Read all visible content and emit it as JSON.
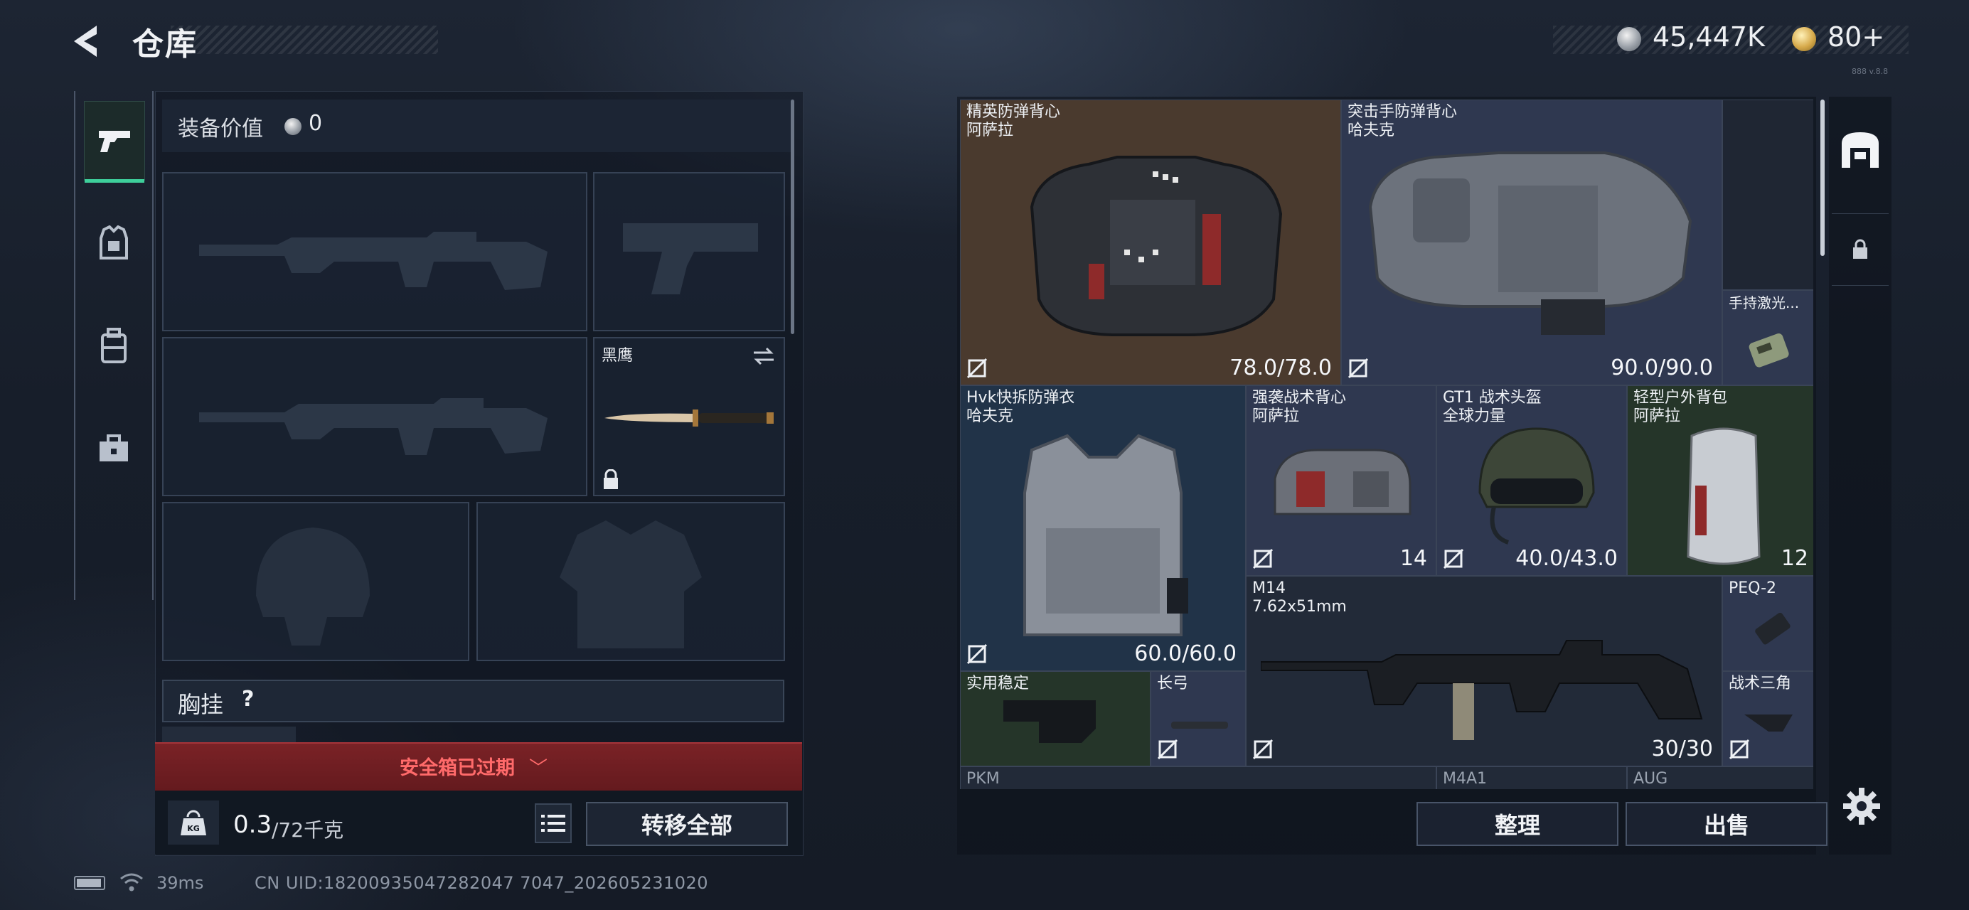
{
  "header": {
    "title": "仓库",
    "currency_amount": "45,447K",
    "token_amount": "80+",
    "version_tag": "888 v.8.8",
    "icons": {
      "back": "back-arrow-icon",
      "currency": "silver-coin-icon",
      "token": "gold-coin-icon"
    }
  },
  "left_rail": {
    "tabs": [
      {
        "name": "weapons",
        "icon": "pistol-icon",
        "active": true
      },
      {
        "name": "gear",
        "icon": "armor-icon",
        "active": false
      },
      {
        "name": "backpack",
        "icon": "backpack-icon",
        "active": false
      },
      {
        "name": "supplies",
        "icon": "toolbox-icon",
        "active": false
      }
    ]
  },
  "loadout": {
    "equip_value_label": "装备价值",
    "equip_value": "0",
    "melee_name": "黑鹰",
    "chest_rig_label": "胸挂",
    "chest_rig_help": "?",
    "safe_box_status": "安全箱已过期",
    "safe_box_chevron": "﹀",
    "weight_current": "0.3",
    "weight_limit": "/72千克",
    "transfer_all": "转移全部"
  },
  "status": {
    "ping": "39ms",
    "uid": "CN UID:18200935047282047 7047_202605231020"
  },
  "stash": {
    "items": [
      {
        "name": "精英防弹背心",
        "origin": "阿萨拉",
        "value": "78.0/78.0",
        "color": "tan"
      },
      {
        "name": "突击手防弹背心",
        "origin": "哈夫克",
        "value": "90.0/90.0",
        "color": "slate"
      },
      {
        "name": "手持激光...",
        "origin": "",
        "value": "",
        "color": "slate"
      },
      {
        "name": "Hvk快拆防弹衣",
        "origin": "哈夫克",
        "value": "60.0/60.0",
        "color": "blue"
      },
      {
        "name": "强袭战术背心",
        "origin": "阿萨拉",
        "value": "14",
        "color": "slate"
      },
      {
        "name": "GT1 战术头盔",
        "origin": "全球力量",
        "value": "40.0/43.0",
        "color": "slate"
      },
      {
        "name": "轻型户外背包",
        "origin": "阿萨拉",
        "value": "12",
        "color": "green"
      },
      {
        "name": "M14",
        "origin": "7.62x51mm",
        "value": "30/30",
        "color": "dark"
      },
      {
        "name": "PEQ-2",
        "origin": "",
        "value": "",
        "color": "slate"
      },
      {
        "name": "实用稳定",
        "origin": "",
        "value": "",
        "color": "green"
      },
      {
        "name": "长弓",
        "origin": "",
        "value": "",
        "color": "slate"
      },
      {
        "name": "战术三角",
        "origin": "",
        "value": "",
        "color": "slate"
      },
      {
        "name": "PKM",
        "origin": "",
        "value": "",
        "color": "dark"
      },
      {
        "name": "M4A1",
        "origin": "",
        "value": "",
        "color": "dark"
      },
      {
        "name": "AUG",
        "origin": "",
        "value": "",
        "color": "dark"
      }
    ],
    "sort_label": "整理",
    "sell_label": "出售"
  },
  "colors": {
    "accent_green": "#3ecf9b",
    "alert_red": "#ff6a6a",
    "tan_cell": "#4a3a2e",
    "slate_cell": "#2f3850",
    "blue_cell": "#213348",
    "green_cell": "#253529"
  }
}
